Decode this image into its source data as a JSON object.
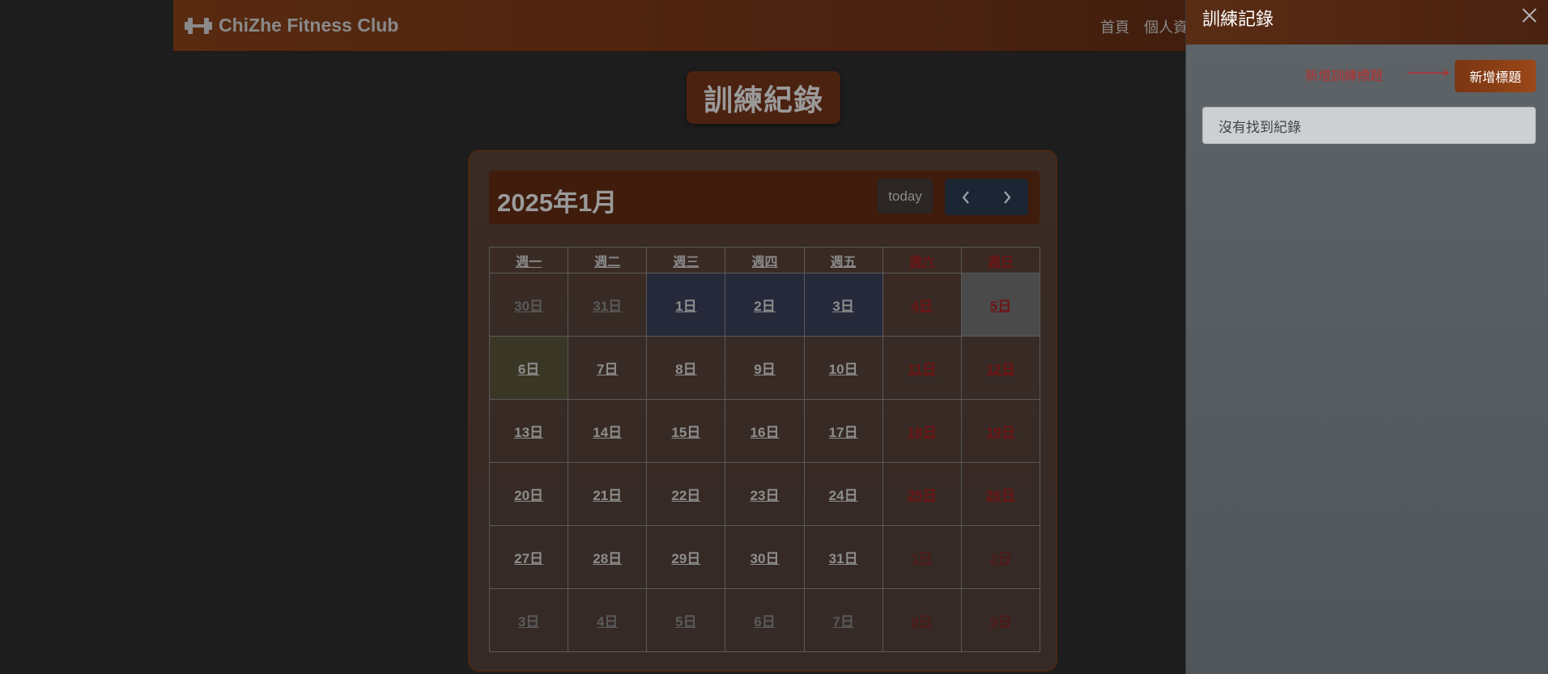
{
  "navbar": {
    "brand": "ChiZhe Fitness Club",
    "links": [
      "首頁",
      "個人資"
    ]
  },
  "page": {
    "title": "訓練紀錄"
  },
  "calendar": {
    "month_label": "2025年1月",
    "today_label": "today",
    "weekdays": [
      "週一",
      "週二",
      "週三",
      "週四",
      "週五",
      "週六",
      "週日"
    ],
    "weeks": [
      [
        "30日",
        "31日",
        "1日",
        "2日",
        "3日",
        "4日",
        "5日"
      ],
      [
        "6日",
        "7日",
        "8日",
        "9日",
        "10日",
        "11日",
        "12日"
      ],
      [
        "13日",
        "14日",
        "15日",
        "16日",
        "17日",
        "18日",
        "19日"
      ],
      [
        "20日",
        "21日",
        "22日",
        "23日",
        "24日",
        "25日",
        "26日"
      ],
      [
        "27日",
        "28日",
        "29日",
        "30日",
        "31日",
        "1日",
        "2日"
      ],
      [
        "3日",
        "4日",
        "5日",
        "6日",
        "7日",
        "8日",
        "9日"
      ]
    ]
  },
  "panel": {
    "title": "訓練記錄",
    "hint": "新增訓練標題",
    "add_button": "新增標題",
    "empty_message": "沒有找到紀錄"
  },
  "colors": {
    "navbar": "#4a2210",
    "accent_orange": "#9a4818",
    "weekend_red": "#6e1414",
    "hint_red": "#b53030",
    "panel_bg": "#5e6468"
  }
}
